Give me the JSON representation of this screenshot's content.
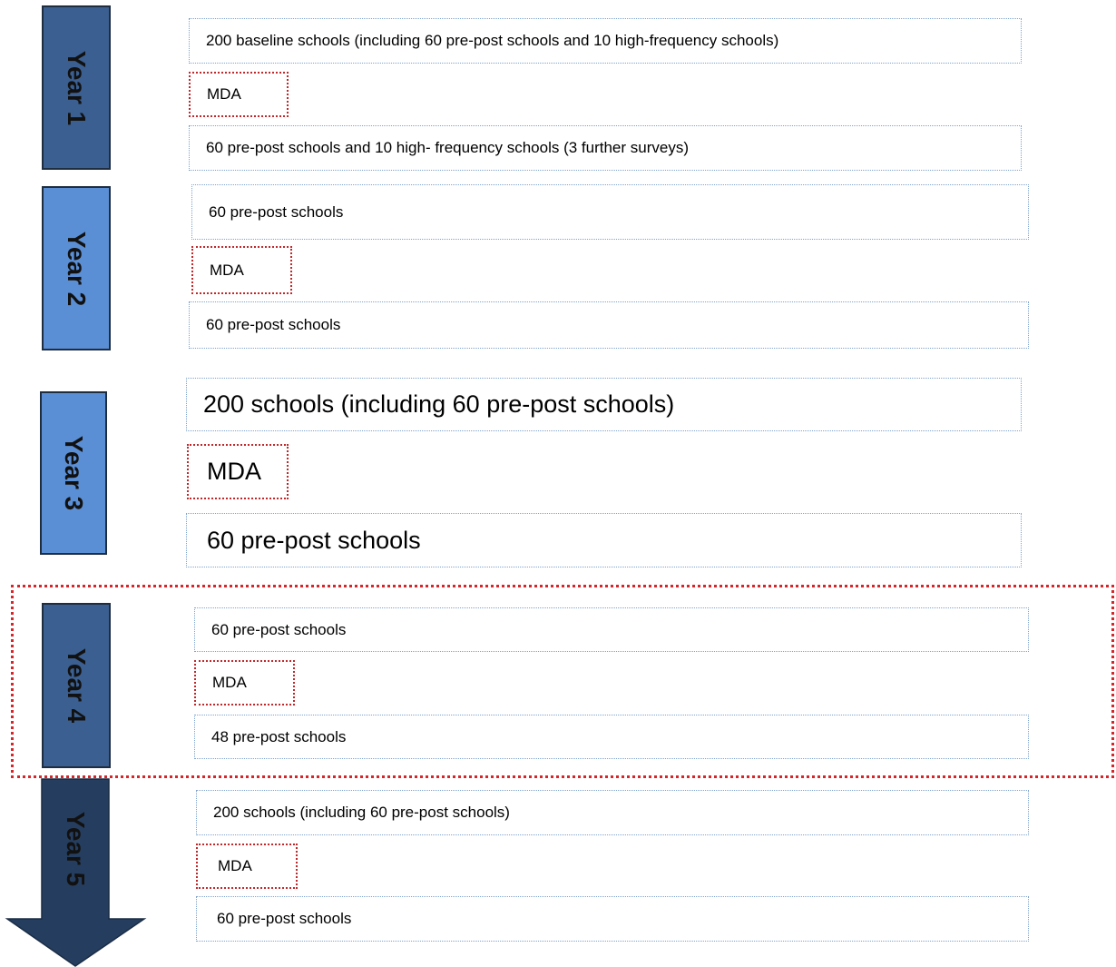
{
  "colors": {
    "year1": "#3b5f90",
    "year2": "#5b8fd5",
    "year3": "#5b8fd5",
    "year4": "#3b5f90",
    "year5": "#253e5f",
    "survey_border": "#7fa3cc",
    "mda_border": "#c0282a",
    "highlight_border": "#d6262a"
  },
  "years": [
    {
      "label": "Year 1",
      "top": "200 baseline schools (including 60 pre-post schools and 10 high-frequency schools)",
      "mda": "MDA",
      "bottom": "60 pre-post schools and 10 high- frequency schools (3 further surveys)"
    },
    {
      "label": "Year 2",
      "top": "60 pre-post schools",
      "mda": "MDA",
      "bottom": "60 pre-post schools"
    },
    {
      "label": "Year 3",
      "top": "200 schools (including 60 pre-post schools)",
      "mda": "MDA",
      "bottom": "60 pre-post schools"
    },
    {
      "label": "Year 4",
      "top": "60 pre-post schools",
      "mda": "MDA",
      "bottom": "48 pre-post schools"
    },
    {
      "label": "Year 5",
      "top": "200 schools (including 60 pre-post schools)",
      "mda": "MDA",
      "bottom": "60 pre-post schools"
    }
  ]
}
